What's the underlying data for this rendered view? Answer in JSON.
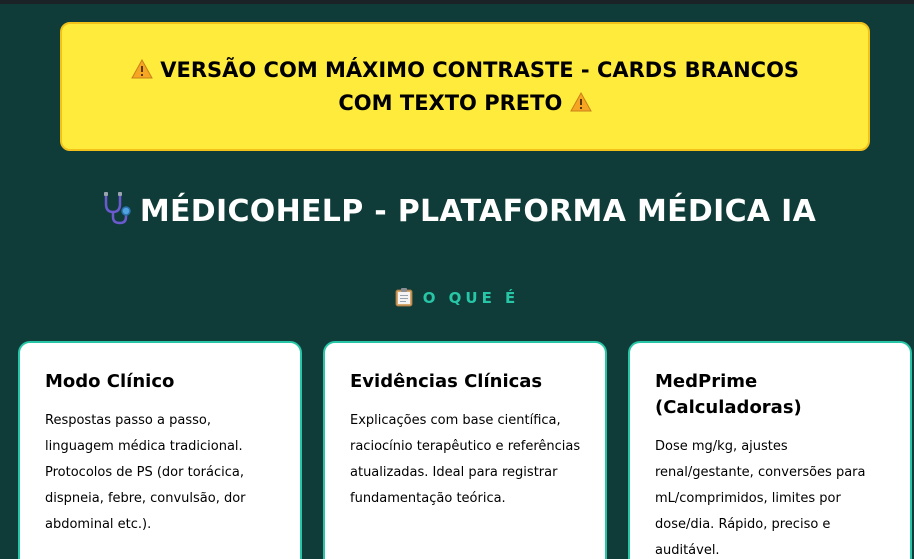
{
  "warning": {
    "text": "VERSÃO COM MÁXIMO CONTRASTE - CARDS BRANCOS COM TEXTO PRETO",
    "icon": "warning-icon"
  },
  "header": {
    "title": "MÉDICOHELP - PLATAFORMA MÉDICA IA",
    "icon": "stethoscope-icon"
  },
  "section": {
    "heading": "O QUE É",
    "icon": "clipboard-icon"
  },
  "cards": [
    {
      "title": "Modo Clínico",
      "text": "Respostas passo a passo, linguagem médica tradicional. Protocolos de PS (dor torácica, dispneia, febre, convulsão, dor abdominal etc.)."
    },
    {
      "title": "Evidências Clínicas",
      "text": "Explicações com base científica, raciocínio terapêutico e referências atualizadas. Ideal para registrar fundamentação teórica."
    },
    {
      "title": "MedPrime (Calculadoras)",
      "text": "Dose mg/kg, ajustes renal/gestante, conversões para mL/comprimidos, limites por dose/dia. Rápido, preciso e auditável."
    }
  ],
  "colors": {
    "background": "#0f3b38",
    "banner": "#ffeb3b",
    "accent": "#26c6a6",
    "card": "#ffffff"
  }
}
